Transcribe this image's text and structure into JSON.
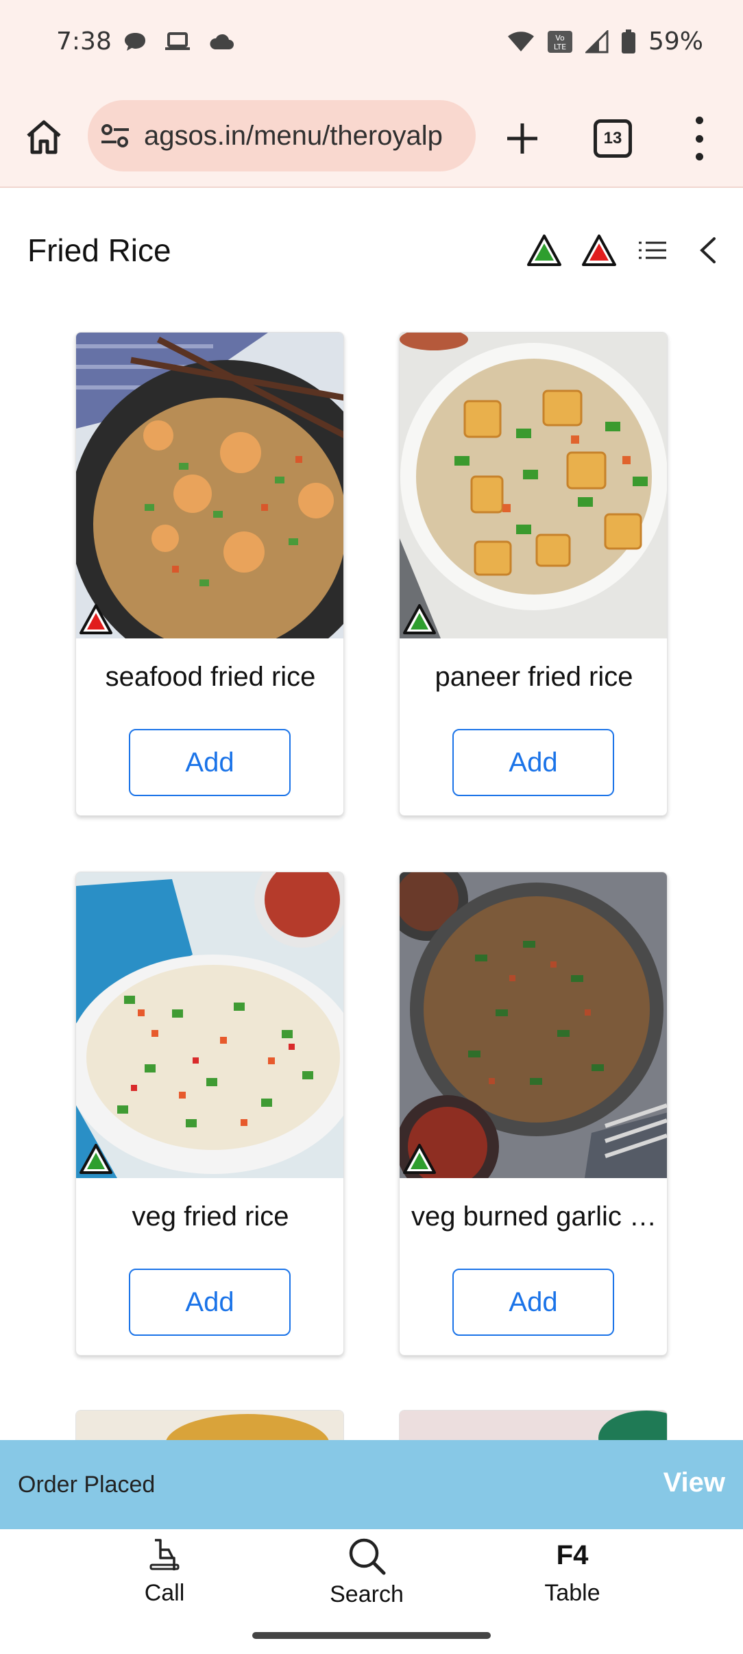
{
  "status_bar": {
    "time": "7:38",
    "battery": "59%",
    "left_icons": [
      "chat-bubble-icon",
      "laptop-icon",
      "cloud-icon"
    ],
    "right_icons": [
      "wifi-icon",
      "volte-icon",
      "signal-icon",
      "battery-icon"
    ]
  },
  "browser": {
    "url": "agsos.in/menu/theroyalp",
    "tab_count": "13"
  },
  "category": {
    "title": "Fried Rice"
  },
  "items": [
    {
      "name": "seafood fried rice",
      "diet": "non-veg",
      "add_label": "Add"
    },
    {
      "name": "paneer fried rice",
      "diet": "veg",
      "add_label": "Add"
    },
    {
      "name": "veg fried rice",
      "diet": "veg",
      "add_label": "Add"
    },
    {
      "name": "veg burned garlic …",
      "diet": "veg",
      "add_label": "Add"
    }
  ],
  "order_bar": {
    "status": "Order Placed",
    "action": "View"
  },
  "bottom_nav": {
    "call_label": "Call",
    "search_label": "Search",
    "table_code": "F4",
    "table_label": "Table"
  },
  "colors": {
    "veg": "#2e9e2e",
    "non_veg": "#e11d1d",
    "accent": "#1a73e8",
    "order_bar": "#87c8e6",
    "browser_bg": "#fdf0ec"
  }
}
